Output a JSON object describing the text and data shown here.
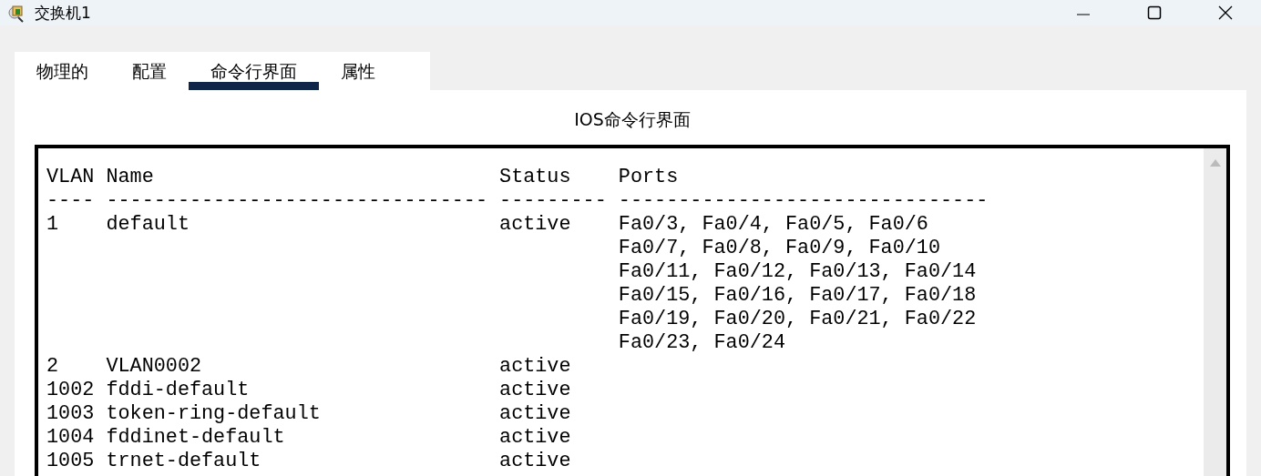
{
  "window": {
    "title": "交换机1"
  },
  "tabs": [
    {
      "label": "物理的",
      "selected": false
    },
    {
      "label": "配置",
      "selected": false
    },
    {
      "label": "命令行界面",
      "selected": true
    },
    {
      "label": "属性",
      "selected": false
    }
  ],
  "panel_title": "IOS命令行界面",
  "terminal": {
    "lines": [
      "VLAN Name                             Status    Ports",
      "---- -------------------------------- --------- -------------------------------",
      "1    default                          active    Fa0/3, Fa0/4, Fa0/5, Fa0/6",
      "                                                Fa0/7, Fa0/8, Fa0/9, Fa0/10",
      "                                                Fa0/11, Fa0/12, Fa0/13, Fa0/14",
      "                                                Fa0/15, Fa0/16, Fa0/17, Fa0/18",
      "                                                Fa0/19, Fa0/20, Fa0/21, Fa0/22",
      "                                                Fa0/23, Fa0/24",
      "2    VLAN0002                         active    ",
      "1002 fddi-default                     active    ",
      "1003 token-ring-default               active    ",
      "1004 fddinet-default                  active    ",
      "1005 trnet-default                    active    "
    ]
  }
}
